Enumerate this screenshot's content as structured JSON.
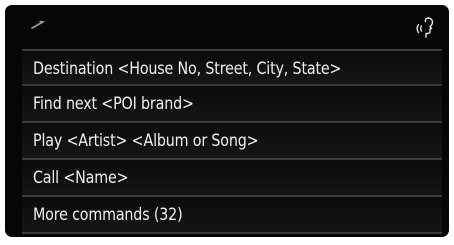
{
  "status_bar": {
    "signal_icon": "signal-strength-icon",
    "voice_icon": "voice-recognition-icon"
  },
  "commands": [
    {
      "label": "Destination <House No, Street, City, State>"
    },
    {
      "label": "Find next <POI brand>"
    },
    {
      "label": "Play <Artist> <Album or Song>"
    },
    {
      "label": "Call <Name>"
    },
    {
      "label": "More commands (32)"
    }
  ],
  "colors": {
    "background": "#050607",
    "text": "#eef0f2",
    "divider": "#3a3b3d"
  }
}
